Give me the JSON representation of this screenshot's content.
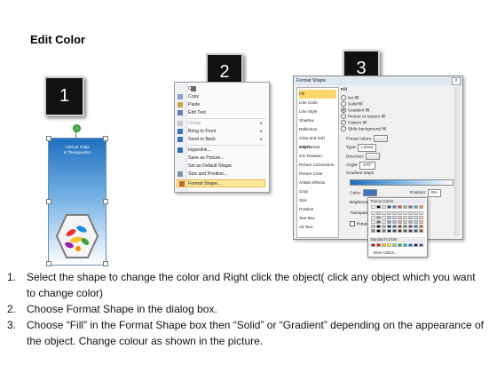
{
  "title": "Edit Color",
  "steps": [
    {
      "num": "1",
      "box_label": "1"
    },
    {
      "num": "2",
      "box_label": "2"
    },
    {
      "num": "3",
      "box_label": "3"
    }
  ],
  "shape": {
    "text_line1": "Clinical Trials",
    "text_line2": "& Therapeutics"
  },
  "context_menu": {
    "items": [
      {
        "label": "Cut",
        "disabled": false,
        "arrow": false
      },
      {
        "label": "Copy",
        "disabled": false,
        "arrow": false
      },
      {
        "label": "Paste",
        "disabled": false,
        "arrow": false
      },
      {
        "label": "Edit Text",
        "disabled": false,
        "arrow": false
      },
      {
        "label": "Group",
        "disabled": true,
        "arrow": true
      },
      {
        "label": "Bring to Front",
        "disabled": false,
        "arrow": true
      },
      {
        "label": "Send to Back",
        "disabled": false,
        "arrow": true
      },
      {
        "label": "Hyperlink...",
        "disabled": false,
        "arrow": false
      },
      {
        "label": "Save as Picture...",
        "disabled": false,
        "arrow": false
      },
      {
        "label": "Set as Default Shape",
        "disabled": false,
        "arrow": false
      },
      {
        "label": "Size and Position...",
        "disabled": false,
        "arrow": false
      },
      {
        "label": "Format Shape...",
        "disabled": false,
        "arrow": false,
        "highlighted": true
      }
    ]
  },
  "format_dialog": {
    "title": "Format Shape",
    "close": "×",
    "categories": [
      "Fill",
      "Line Color",
      "Line Style",
      "Shadow",
      "Reflection",
      "Glow and Soft Edges",
      "3-D Format",
      "3-D Rotation",
      "Picture Corrections",
      "Picture Color",
      "Artistic Effects",
      "Crop",
      "Size",
      "Position",
      "Text Box",
      "Alt Text"
    ],
    "fill_header": "Fill",
    "fill_options": [
      "No fill",
      "Solid fill",
      "Gradient fill",
      "Picture or texture fill",
      "Pattern fill",
      "Slide background fill"
    ],
    "selected_fill": 2,
    "preset_colors": "Preset colors:",
    "type_label": "Type:",
    "type_value": "Linear",
    "direction_label": "Direction:",
    "angle_label": "Angle:",
    "angle_value": "270°",
    "gradient_stops": "Gradient stops",
    "color_label": "Color:",
    "position_label": "Position:",
    "position_value": "0%",
    "brightness_label": "Brightness",
    "transparency_label": "Transparency",
    "rotate_label": "Rotate with shape"
  },
  "palette": {
    "theme_header": "Theme Colors",
    "standard_header": "Standard Colors",
    "more": "More Colors...",
    "theme_colors": [
      "#ffffff",
      "#000000",
      "#eeece1",
      "#1f497d",
      "#4f81bd",
      "#c0504d",
      "#9bbb59",
      "#8064a2",
      "#4bacc6",
      "#f79646"
    ],
    "standard_colors": [
      "#c00000",
      "#ff0000",
      "#ffc000",
      "#ffff00",
      "#92d050",
      "#00b050",
      "#00b0f0",
      "#0070c0",
      "#002060",
      "#7030a0"
    ]
  },
  "instructions": [
    {
      "num": "1.",
      "text": "Select the shape to change the color and Right click the object( click any object which you want to change color)"
    },
    {
      "num": "2.",
      "text": "Choose Format Shape in the dialog box."
    },
    {
      "num": "3.",
      "text": "Choose “Fill” in the Format Shape box then “Solid” or “Gradient” depending on the appearance of the object. Change colour as shown in the picture."
    }
  ]
}
